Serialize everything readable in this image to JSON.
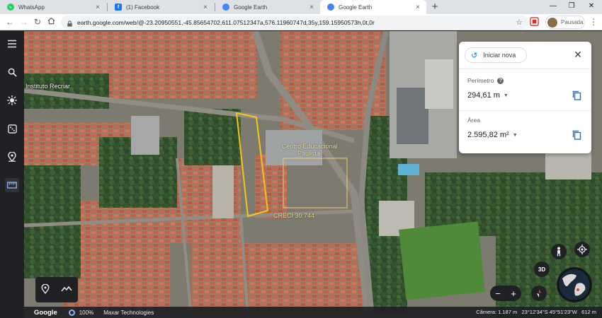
{
  "tabs": [
    {
      "title": "WhatsApp",
      "icon": "whatsapp-icon",
      "color": "#25d366"
    },
    {
      "title": "(1) Facebook",
      "icon": "facebook-icon",
      "color": "#1877f2"
    },
    {
      "title": "Google Earth",
      "icon": "google-earth-icon",
      "color": "#4285f4"
    },
    {
      "title": "Google Earth",
      "icon": "google-earth-icon",
      "color": "#4285f4",
      "active": true
    }
  ],
  "toolbar": {
    "url": "earth.google.com/web/@-23.20950551,-45.85654702,611.07512347a,576.11960747d,35y,159.15950573h,0t,0r",
    "profile_label": "Pausada"
  },
  "measure": {
    "new_label": "Iniciar nova",
    "perimeter_label": "Perímetro",
    "perimeter_value": "294,61 m",
    "area_label": "Área",
    "area_value": "2.595,82 m²"
  },
  "map": {
    "place_label_1": "Instituto Recriar",
    "watermark_1": "Centro Educacional",
    "watermark_2": "Paulista",
    "watermark_3": "CRECI 30.744",
    "view_3d_label": "3D",
    "zoom_in": "+",
    "zoom_out": "−"
  },
  "status": {
    "brand": "Google",
    "zoom": "100%",
    "imagery": "Maxar Technologies",
    "camera": "Câmera: 1.187 m",
    "coords": "23°12'34\"S 45°51'23\"W",
    "elevation": "612 m"
  },
  "colors": {
    "accent": "#1a73e8",
    "polygon": "#f5c518"
  }
}
